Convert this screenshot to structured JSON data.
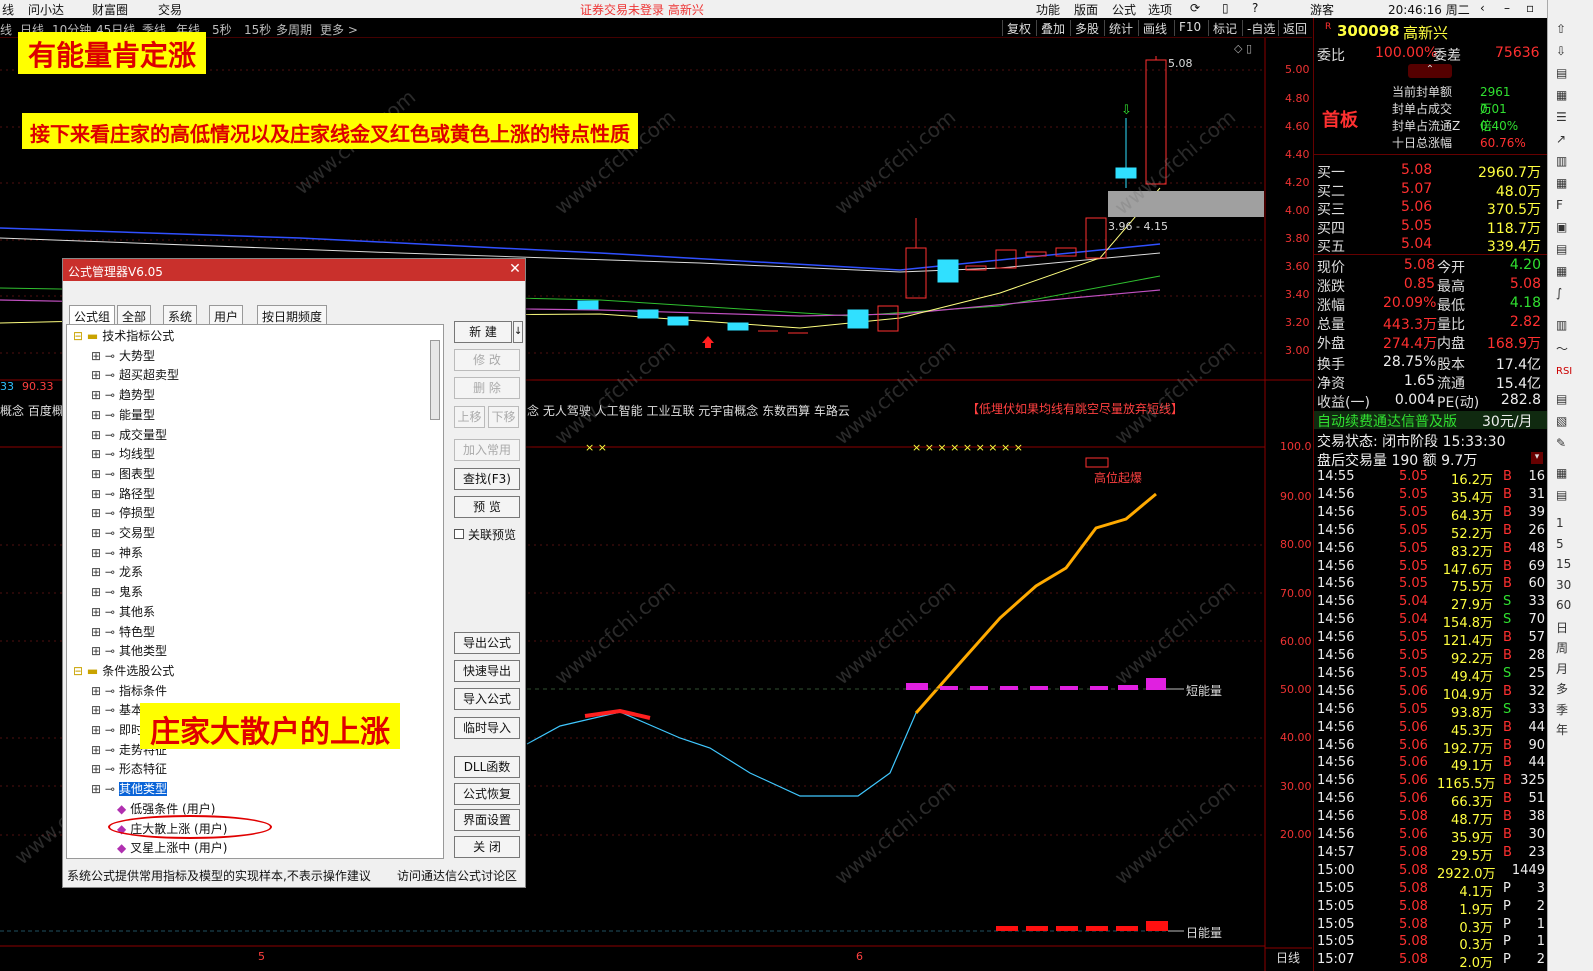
{
  "menu": {
    "left": [
      "线",
      "问小达",
      "财富圈",
      "交易"
    ],
    "notice": "证券交易未登录  高新兴",
    "right": [
      "功能",
      "版面",
      "公式",
      "选项"
    ],
    "user": "游客",
    "time": "20:46:16 周二"
  },
  "periods": [
    "线",
    "日线",
    "10分钟",
    "45日线",
    "季线",
    "年线",
    "5秒",
    "15秒",
    "多周期",
    "更多 >"
  ],
  "tools": [
    "复权",
    "叠加",
    "多股",
    "统计",
    "画线",
    "F10",
    "标记",
    "-自选",
    "返回"
  ],
  "price_axis": [
    "5.00",
    "4.80",
    "4.60",
    "4.40",
    "4.20",
    "4.00",
    "3.80",
    "3.60",
    "3.40",
    "3.20",
    "3.00"
  ],
  "indicator_axis": [
    "100.0",
    "90.00",
    "80.00",
    "70.00",
    "60.00",
    "50.00",
    "40.00",
    "30.00",
    "20.00"
  ],
  "chart": {
    "high_label": "5.08",
    "range_label": "3.96 - 4.15",
    "left_labels": [
      "33",
      "90.33"
    ],
    "concepts_left": "概念 百度概",
    "concepts_right": "念 无人驾驶 人工智能 工业互联 元宇宙概念 东数西算 车路云",
    "tip": "【低埋伏如果均线有跳空尽量放弃短线】",
    "high_burst": "高位起爆",
    "short_energy": "短能量",
    "day_energy": "日能量",
    "bottom_right": "日线",
    "date_marks": [
      "5",
      "6"
    ]
  },
  "banners": {
    "b1": "有能量肯定涨",
    "b2": "接下来看庄家的高低情况以及庄家线金叉红色或黄色上涨的特点性质",
    "b3": "庄家大散户的上涨"
  },
  "watermark": "www.cfchi.com",
  "dialog": {
    "title": "公式管理器V6.05",
    "tabs": [
      "公式组",
      "全部",
      "系统",
      "用户",
      "按日期频度"
    ],
    "tree": [
      {
        "t": "技术指标公式",
        "lvl": 0
      },
      {
        "t": "大势型",
        "lvl": 1
      },
      {
        "t": "超买超卖型",
        "lvl": 1
      },
      {
        "t": "趋势型",
        "lvl": 1
      },
      {
        "t": "能量型",
        "lvl": 1
      },
      {
        "t": "成交量型",
        "lvl": 1
      },
      {
        "t": "均线型",
        "lvl": 1
      },
      {
        "t": "图表型",
        "lvl": 1
      },
      {
        "t": "路径型",
        "lvl": 1
      },
      {
        "t": "停损型",
        "lvl": 1
      },
      {
        "t": "交易型",
        "lvl": 1
      },
      {
        "t": "神系",
        "lvl": 1
      },
      {
        "t": "龙系",
        "lvl": 1
      },
      {
        "t": "鬼系",
        "lvl": 1
      },
      {
        "t": "其他系",
        "lvl": 1
      },
      {
        "t": "特色型",
        "lvl": 1
      },
      {
        "t": "其他类型",
        "lvl": 1
      },
      {
        "t": "条件选股公式",
        "lvl": 0
      },
      {
        "t": "指标条件",
        "lvl": 1
      },
      {
        "t": "基本",
        "lvl": 1
      },
      {
        "t": "即时",
        "lvl": 1
      },
      {
        "t": "走势特征",
        "lvl": 1
      },
      {
        "t": "形态特征",
        "lvl": 1
      },
      {
        "t": "其他类型",
        "lvl": 1
      },
      {
        "t": "低强条件 (用户)",
        "lvl": 2
      },
      {
        "t": "庄大散上涨 (用户)",
        "lvl": 2
      },
      {
        "t": "叉星上涨中 (用户)",
        "lvl": 2
      }
    ],
    "buttons": [
      "新 建",
      "修 改",
      "删 除",
      "加入常用",
      "查找(F3)",
      "预 览",
      "导出公式",
      "快速导出",
      "导入公式",
      "临时导入",
      "DLL函数",
      "公式恢复",
      "界面设置",
      "关 闭"
    ],
    "move_up": "上移",
    "move_down": "下移",
    "preview_check": "关联预览",
    "status_left": "系统公式提供常用指标及模型的实现样本,不表示操作建议",
    "status_right": "访问通达信公式讨论区"
  },
  "quote": {
    "code": "300098",
    "name": "高新兴",
    "wb_label": "委比",
    "wb_value": "100.00%",
    "wc_label": "委差",
    "wc_value": "75636",
    "board": "首板",
    "seal": [
      {
        "k": "当前封单额",
        "v": "2961万"
      },
      {
        "k": "封单占成交",
        "v": "0.01倍"
      },
      {
        "k": "封单占流通Z",
        "v": "0.40%"
      },
      {
        "k": "十日总涨幅",
        "v": "60.76%"
      }
    ],
    "bids": [
      {
        "k": "买一",
        "p": "5.08",
        "v": "2960.7万"
      },
      {
        "k": "买二",
        "p": "5.07",
        "v": "48.0万"
      },
      {
        "k": "买三",
        "p": "5.06",
        "v": "370.5万"
      },
      {
        "k": "买四",
        "p": "5.05",
        "v": "118.7万"
      },
      {
        "k": "买五",
        "p": "5.04",
        "v": "339.4万"
      }
    ],
    "stats": [
      {
        "k1": "现价",
        "v1": "5.08",
        "k2": "今开",
        "v2": "4.20"
      },
      {
        "k1": "涨跌",
        "v1": "0.85",
        "k2": "最高",
        "v2": "5.08"
      },
      {
        "k1": "涨幅",
        "v1": "20.09%",
        "k2": "最低",
        "v2": "4.18"
      },
      {
        "k1": "总量",
        "v1": "443.3万",
        "k2": "量比",
        "v2": "2.82"
      },
      {
        "k1": "外盘",
        "v1": "274.4万",
        "k2": "内盘",
        "v2": "168.9万"
      },
      {
        "k1": "换手",
        "v1": "28.75%",
        "k2": "股本",
        "v2": "17.4亿"
      },
      {
        "k1": "净资",
        "v1": "1.65",
        "k2": "流通",
        "v2": "15.4亿"
      },
      {
        "k1": "收益(一)",
        "v1": "0.004",
        "k2": "PE(动)",
        "v2": "282.8"
      }
    ],
    "ad": "自动续费通达信普及版",
    "ad_price": "30元/月",
    "trade_state": "交易状态: 闭市阶段 15:33:30",
    "after_hours": "盘后交易量 190 额 9.7万",
    "ticks": [
      {
        "t": "14:55",
        "p": "5.05",
        "v": "16.2万",
        "d": "B",
        "n": "16"
      },
      {
        "t": "14:56",
        "p": "5.05",
        "v": "35.4万",
        "d": "B",
        "n": "31"
      },
      {
        "t": "14:56",
        "p": "5.05",
        "v": "64.3万",
        "d": "B",
        "n": "39"
      },
      {
        "t": "14:56",
        "p": "5.05",
        "v": "52.2万",
        "d": "B",
        "n": "26"
      },
      {
        "t": "14:56",
        "p": "5.05",
        "v": "83.2万",
        "d": "B",
        "n": "48"
      },
      {
        "t": "14:56",
        "p": "5.05",
        "v": "147.6万",
        "d": "B",
        "n": "69"
      },
      {
        "t": "14:56",
        "p": "5.05",
        "v": "75.5万",
        "d": "B",
        "n": "60"
      },
      {
        "t": "14:56",
        "p": "5.04",
        "v": "27.9万",
        "d": "S",
        "n": "33"
      },
      {
        "t": "14:56",
        "p": "5.04",
        "v": "154.8万",
        "d": "S",
        "n": "70"
      },
      {
        "t": "14:56",
        "p": "5.05",
        "v": "121.4万",
        "d": "B",
        "n": "57"
      },
      {
        "t": "14:56",
        "p": "5.05",
        "v": "92.2万",
        "d": "B",
        "n": "28"
      },
      {
        "t": "14:56",
        "p": "5.05",
        "v": "49.4万",
        "d": "S",
        "n": "25"
      },
      {
        "t": "14:56",
        "p": "5.06",
        "v": "104.9万",
        "d": "B",
        "n": "32"
      },
      {
        "t": "14:56",
        "p": "5.05",
        "v": "93.8万",
        "d": "S",
        "n": "33"
      },
      {
        "t": "14:56",
        "p": "5.06",
        "v": "45.3万",
        "d": "B",
        "n": "44"
      },
      {
        "t": "14:56",
        "p": "5.06",
        "v": "192.7万",
        "d": "B",
        "n": "90"
      },
      {
        "t": "14:56",
        "p": "5.06",
        "v": "49.1万",
        "d": "B",
        "n": "44"
      },
      {
        "t": "14:56",
        "p": "5.06",
        "v": "1165.5万",
        "d": "B",
        "n": "325"
      },
      {
        "t": "14:56",
        "p": "5.06",
        "v": "66.3万",
        "d": "B",
        "n": "51"
      },
      {
        "t": "14:56",
        "p": "5.08",
        "v": "48.7万",
        "d": "B",
        "n": "38"
      },
      {
        "t": "14:56",
        "p": "5.06",
        "v": "35.9万",
        "d": "B",
        "n": "30"
      },
      {
        "t": "14:57",
        "p": "5.08",
        "v": "29.5万",
        "d": "B",
        "n": "23"
      },
      {
        "t": "15:00",
        "p": "5.08",
        "v": "2922.0万",
        "d": "",
        "n": "1449"
      },
      {
        "t": "15:05",
        "p": "5.08",
        "v": "4.1万",
        "d": "P",
        "n": "3"
      },
      {
        "t": "15:05",
        "p": "5.08",
        "v": "1.9万",
        "d": "P",
        "n": "2"
      },
      {
        "t": "15:05",
        "p": "5.08",
        "v": "0.3万",
        "d": "P",
        "n": "1"
      },
      {
        "t": "15:05",
        "p": "5.08",
        "v": "0.3万",
        "d": "P",
        "n": "1"
      },
      {
        "t": "15:07",
        "p": "5.08",
        "v": "2.0万",
        "d": "P",
        "n": "2"
      }
    ]
  },
  "side_tools": [
    "1",
    "5",
    "15",
    "30",
    "60",
    "日",
    "周",
    "月",
    "多",
    "季",
    "年"
  ],
  "colors": {
    "up": "#ff3030",
    "down": "#30e0ff",
    "accent": "#c9302c",
    "banner_bg": "#ffff00"
  }
}
